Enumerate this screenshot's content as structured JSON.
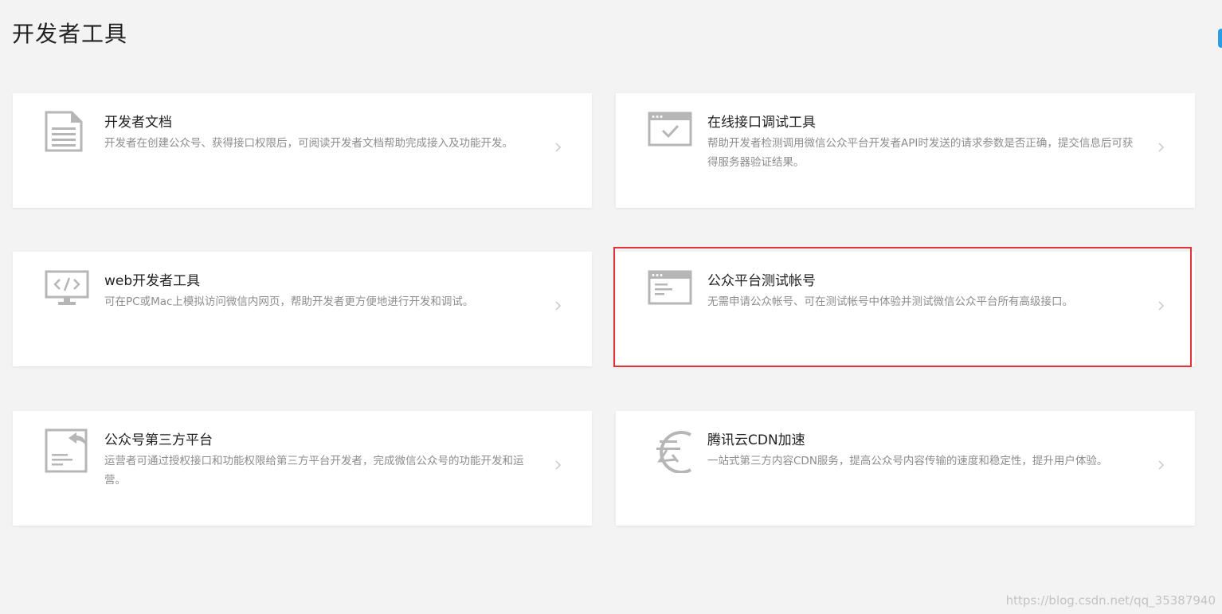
{
  "page": {
    "title": "开发者工具",
    "watermark": "https://blog.csdn.net/qq_35387940"
  },
  "colors": {
    "background": "#f3f3f4",
    "card": "#ffffff",
    "icon": "#b6b6b6",
    "highlight": "#e2323a",
    "edge_tab": "#2b9de3"
  },
  "cards": [
    {
      "title": "开发者文档",
      "desc": "开发者在创建公众号、获得接口权限后，可阅读开发者文档帮助完成接入及功能开发。",
      "icon": "document-icon"
    },
    {
      "title": "在线接口调试工具",
      "desc": "帮助开发者检测调用微信公众平台开发者API时发送的请求参数是否正确，提交信息后可获得服务器验证结果。",
      "icon": "window-check-icon"
    },
    {
      "title": "web开发者工具",
      "desc": "可在PC或Mac上模拟访问微信内网页，帮助开发者更方便地进行开发和调试。",
      "icon": "monitor-code-icon"
    },
    {
      "title": "公众平台测试帐号",
      "desc": "无需申请公众帐号、可在测试帐号中体验并测试微信公众平台所有高级接口。",
      "icon": "window-list-icon"
    },
    {
      "title": "公众号第三方平台",
      "desc": "运营者可通过授权接口和功能权限给第三方平台开发者，完成微信公众号的功能开发和运营。",
      "icon": "document-share-icon"
    },
    {
      "title": "腾讯云CDN加速",
      "desc": "一站式第三方内容CDN服务，提高公众号内容传输的速度和稳定性，提升用户体验。",
      "icon": "cloud-logo-icon"
    }
  ]
}
